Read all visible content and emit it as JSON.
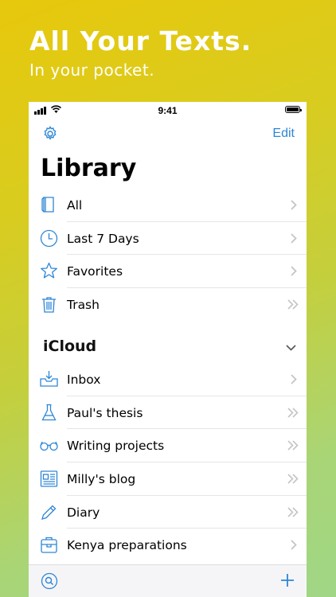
{
  "promo": {
    "headline": "All Your Texts.",
    "subline": "In your pocket."
  },
  "status_bar": {
    "time": "9:41"
  },
  "nav": {
    "edit_label": "Edit"
  },
  "library": {
    "title": "Library",
    "items": [
      {
        "label": "All",
        "icon": "book-icon",
        "chevron": "single"
      },
      {
        "label": "Last 7 Days",
        "icon": "clock-icon",
        "chevron": "single"
      },
      {
        "label": "Favorites",
        "icon": "star-icon",
        "chevron": "single"
      },
      {
        "label": "Trash",
        "icon": "trash-icon",
        "chevron": "double"
      }
    ]
  },
  "icloud": {
    "title": "iCloud",
    "items": [
      {
        "label": "Inbox",
        "icon": "inbox-icon",
        "chevron": "single"
      },
      {
        "label": "Paul's thesis",
        "icon": "flask-icon",
        "chevron": "double"
      },
      {
        "label": "Writing projects",
        "icon": "glasses-icon",
        "chevron": "double"
      },
      {
        "label": "Milly's blog",
        "icon": "newspaper-icon",
        "chevron": "double"
      },
      {
        "label": "Diary",
        "icon": "pencil-icon",
        "chevron": "double"
      },
      {
        "label": "Kenya preparations",
        "icon": "backpack-icon",
        "chevron": "single"
      }
    ]
  },
  "colors": {
    "accent": "#2d86d6",
    "chevron": "#c4c4c9",
    "separator": "#e5e5ea"
  }
}
